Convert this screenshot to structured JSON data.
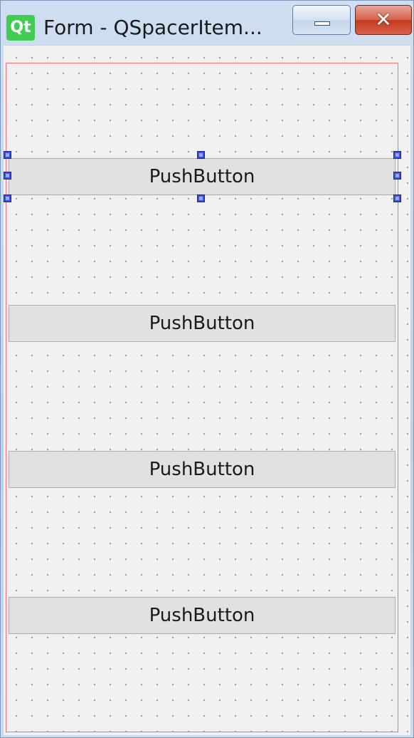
{
  "window": {
    "logo_text": "Qt",
    "title": "Form - QSpacerItem...",
    "close_glyph": "✕"
  },
  "form": {
    "buttons": [
      {
        "label": "PushButton",
        "selected": true
      },
      {
        "label": "PushButton",
        "selected": false
      },
      {
        "label": "PushButton",
        "selected": false
      },
      {
        "label": "PushButton",
        "selected": false
      }
    ]
  },
  "colors": {
    "layout_frame": "#ff6f6f",
    "selection_handle": "#3b4fe0",
    "qt_green": "#41cd52"
  },
  "icons": [
    "qt-logo-icon",
    "minimize-icon",
    "close-icon"
  ]
}
